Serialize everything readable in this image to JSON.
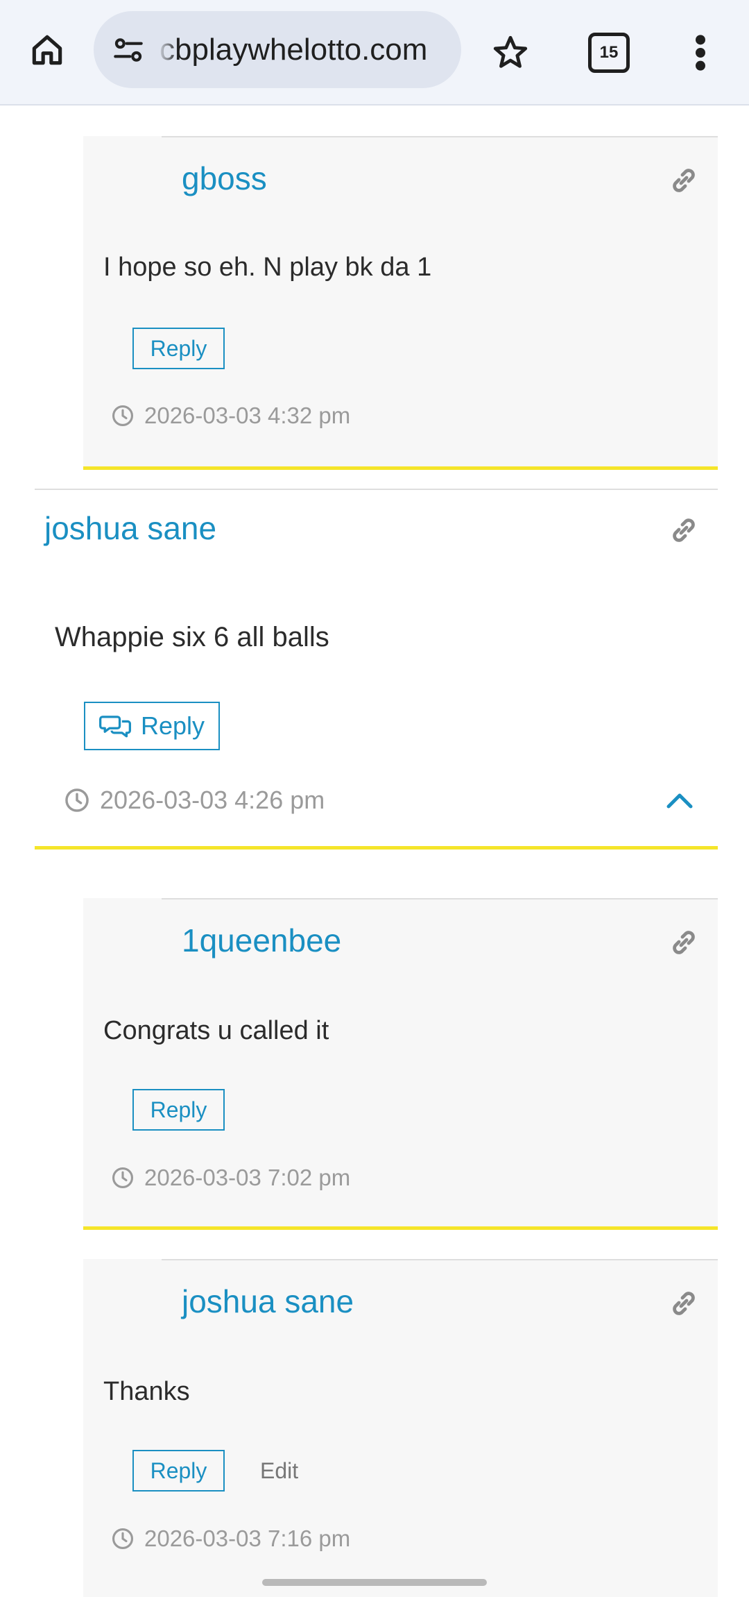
{
  "browser": {
    "url": "cbplaywhelotto.com",
    "tab_count": "15"
  },
  "comments": [
    {
      "author": "gboss",
      "text": "I hope so eh. N play bk da 1",
      "reply_label": "Reply",
      "time": "2026-03-03 4:32 pm"
    },
    {
      "author": "joshua sane",
      "text": "Whappie six 6 all balls",
      "reply_label": "Reply",
      "time": "2026-03-03 4:26 pm"
    },
    {
      "author": "1queenbee",
      "text": "Congrats u called it",
      "reply_label": "Reply",
      "time": "2026-03-03 7:02 pm"
    },
    {
      "author": "joshua sane",
      "text": "Thanks",
      "reply_label": "Reply",
      "edit_label": "Edit",
      "time": "2026-03-03 7:16 pm"
    }
  ],
  "colors": {
    "accent": "#1a8fc2",
    "divider": "#f5e52a",
    "nested_bg": "#f7f7f7"
  }
}
